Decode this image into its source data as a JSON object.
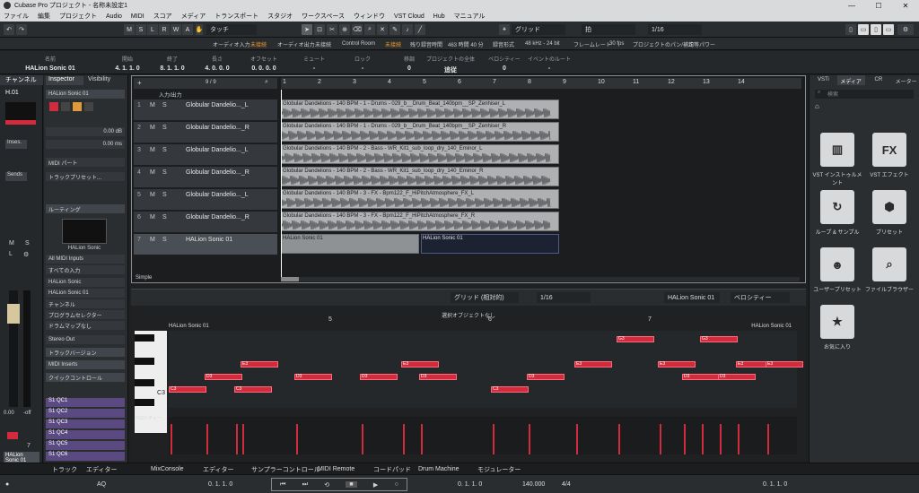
{
  "window": {
    "title": "Cubase Pro プロジェクト - 名称未設定1"
  },
  "menu": [
    "ファイル",
    "編集",
    "プロジェクト",
    "Audio",
    "MIDI",
    "スコア",
    "メディア",
    "トランスポート",
    "スタジオ",
    "ワークスペース",
    "ウィンドウ",
    "VST Cloud",
    "Hub",
    "マニュアル"
  ],
  "toolbar": {
    "modes": [
      "M",
      "S",
      "L",
      "R",
      "W",
      "A"
    ],
    "touch_mode": "タッチ",
    "grid_type": "グリッド",
    "grid_value": "拍",
    "quantize": "1/16"
  },
  "status": {
    "audio_input": "オーディオ入力",
    "audio_input_val": "未接続",
    "audio_output": "オーディオ出力",
    "audio_output_val": "未接続",
    "control_room": "Control Room",
    "control_room_val": "未接続",
    "rec_time_label": "残り録音時間",
    "rec_time_val": "463 時間 40 分",
    "rec_format_label": "録音形式",
    "rec_format_val": "48 kHz - 24 bit",
    "frame_rate_label": "フレームレート",
    "frame_rate_val": "30 fps",
    "pan_label": "プロジェクトのパン/補正",
    "pan_val": "均等パワー"
  },
  "infoline": [
    {
      "label": "名前",
      "value": "HALion Sonic 01"
    },
    {
      "label": "開始",
      "value": "4. 1. 1. 0"
    },
    {
      "label": "終了",
      "value": "8. 1. 1. 0"
    },
    {
      "label": "長さ",
      "value": "4. 0. 0. 0"
    },
    {
      "label": "オフセット",
      "value": "0. 0. 0. 0"
    },
    {
      "label": "ミュート",
      "value": "-"
    },
    {
      "label": "ロック",
      "value": "-"
    },
    {
      "label": "移調",
      "value": "0"
    },
    {
      "label": "プロジェクトの全体",
      "value": "追従"
    },
    {
      "label": "ベロシティー",
      "value": "0"
    },
    {
      "label": "イベントのルート",
      "value": "-"
    }
  ],
  "left_zone": {
    "tab": "チャンネル",
    "channel": "H.01",
    "inserts": "Inses.",
    "sends": "Sends",
    "level": "0.00",
    "off": "-off",
    "track_no": "7",
    "name": "HALion Sonic 01"
  },
  "inspector": {
    "tabs": [
      "Inspector",
      "Visibility"
    ],
    "track": "HALion Sonic 01",
    "volume": "0.00 dB",
    "delay": "0.00 ms",
    "midi_part": "MIDI パート",
    "track_preset": "トラックプリセット...",
    "routing": "ルーティング",
    "instrument": "HALion Sonic",
    "midi_input": "All MIDI Inputs",
    "all_inputs": "すべての入力",
    "output_inst": "HALion Sonic",
    "output_ch": "HALion Sonic 01",
    "channel": "チャンネル",
    "program": "プログラムセレクター",
    "drummap": "ドラムマップなし",
    "stereo_out": "Stereo Out",
    "track_version": "トラックバージョン",
    "midi_inserts": "MIDI Inserts",
    "quick_controls": "クイックコントロール",
    "qc": [
      "S1 QC1",
      "S1 QC2",
      "S1 QC3",
      "S1 QC4",
      "S1 QC5",
      "S1 QC6"
    ]
  },
  "project": {
    "input_output": "入力/出力",
    "counter": "9 / 9",
    "simple": "Simple",
    "ruler": [
      "1",
      "2",
      "3",
      "4",
      "5",
      "6",
      "7",
      "8",
      "9",
      "10",
      "11",
      "12",
      "13",
      "14"
    ],
    "tracks": [
      {
        "num": "1",
        "name": "Globular Dandelio..._L",
        "event": "Globular Dandelions - 140 BPM - 1 - Drums - 029_b__Drum_Beat_140bpm__SP_Zenhiser_L"
      },
      {
        "num": "2",
        "name": "Globular Dandelio..._R",
        "event": "Globular Dandelions - 140 BPM - 1 - Drums - 029_b__Drum_Beat_140bpm__SP_Zenhiser_R"
      },
      {
        "num": "3",
        "name": "Globular Dandelio..._L",
        "event": "Globular Dandelions - 140 BPM - 2 - Bass - WR_Kit1_sub_loop_dry_140_Eminor_L"
      },
      {
        "num": "4",
        "name": "Globular Dandelio..._R",
        "event": "Globular Dandelions - 140 BPM - 2 - Bass - WR_Kit1_sub_loop_dry_140_Eminor_R"
      },
      {
        "num": "5",
        "name": "Globular Dandelio..._L",
        "event": "Globular Dandelions - 140 BPM - 3 - FX - Bpm122_F_HiPitchAtmosphere_FX_L"
      },
      {
        "num": "6",
        "name": "Globular Dandelio..._R",
        "event": "Globular Dandelions - 140 BPM - 3 - FX - Bpm122_F_HiPitchAtmosphere_FX_R"
      },
      {
        "num": "7",
        "name": "HALion Sonic 01",
        "event": "HALion Sonic 01"
      }
    ]
  },
  "editor": {
    "grid_mode": "グリッド (相対的)",
    "quantize": "1/16",
    "instrument": "HALion Sonic 01",
    "velocity_lane": "ベロシティー",
    "no_selection": "選択オブジェクトなし",
    "part_name": "HALion Sonic 01",
    "ruler": [
      "5",
      "6",
      "7"
    ],
    "key_c3": "C3",
    "velocity_label": "ベロシティー",
    "notes": [
      {
        "label": "C3",
        "bar": 0.0,
        "row": 4
      },
      {
        "label": "E3",
        "bar": 0.6,
        "row": 2
      },
      {
        "label": "D3",
        "bar": 0.3,
        "row": 3
      },
      {
        "label": "C3",
        "bar": 0.55,
        "row": 4
      },
      {
        "label": "D3",
        "bar": 1.05,
        "row": 3
      },
      {
        "label": "D3",
        "bar": 1.6,
        "row": 3
      },
      {
        "label": "E3",
        "bar": 1.95,
        "row": 2
      },
      {
        "label": "D3",
        "bar": 2.1,
        "row": 3
      },
      {
        "label": "C3",
        "bar": 2.7,
        "row": 4
      },
      {
        "label": "D3",
        "bar": 3.0,
        "row": 3
      },
      {
        "label": "E3",
        "bar": 3.4,
        "row": 2
      },
      {
        "label": "G3",
        "bar": 3.75,
        "row": 0
      },
      {
        "label": "E3",
        "bar": 4.1,
        "row": 2
      },
      {
        "label": "D3",
        "bar": 4.3,
        "row": 3
      },
      {
        "label": "G3",
        "bar": 4.45,
        "row": 0
      },
      {
        "label": "D3",
        "bar": 4.6,
        "row": 3
      },
      {
        "label": "E3",
        "bar": 4.75,
        "row": 2
      },
      {
        "label": "E3",
        "bar": 5.0,
        "row": 2
      }
    ]
  },
  "right_zone": {
    "tabs": [
      "VSTi",
      "メディア",
      "CR",
      "メーター"
    ],
    "search": "検索",
    "items": [
      {
        "icon": "piano-keys-icon",
        "label": "VST インストゥルメント"
      },
      {
        "icon": "fx-icon",
        "label": "VST エフェクト"
      },
      {
        "icon": "loop-icon",
        "label": "ループ & サンプル"
      },
      {
        "icon": "preset-icon",
        "label": "プリセット"
      },
      {
        "icon": "user-preset-icon",
        "label": "ユーザープリセット"
      },
      {
        "icon": "file-browser-icon",
        "label": "ファイルブラウザー"
      },
      {
        "icon": "star-icon",
        "label": "お気に入り"
      }
    ]
  },
  "bottom_tabs": {
    "left": [
      "トラック",
      "エディター"
    ],
    "center": [
      "MixConsole",
      "エディター",
      "サンプラーコントロール",
      "MIDI Remote",
      "コードパッド",
      "Drum Machine",
      "モジュレーター"
    ]
  },
  "transport": {
    "left_locator": "0. 1. 1. 0",
    "right_locator": "0. 1. 1. 0",
    "position": "0. 1. 1. 0",
    "position2": "0. 1. 1. 0",
    "tempo": "140.000",
    "signature": "4/4",
    "aq": "AQ"
  },
  "colors": {
    "accent": "#d22b3d",
    "orange": "#f39a2a",
    "event_bg": "#aeb0b2",
    "selected": "#1d2233"
  }
}
